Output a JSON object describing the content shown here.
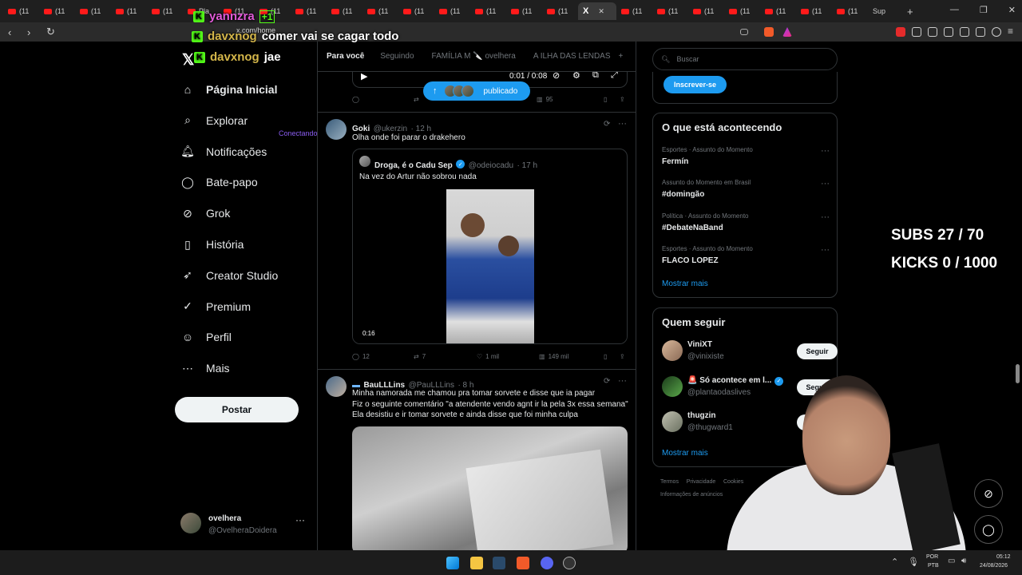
{
  "browser": {
    "tabs": [
      "(11",
      "(11",
      "(11",
      "(11",
      "(11",
      "Pla",
      "(11",
      "(11",
      "(11",
      "(11",
      "(11",
      "(11",
      "(11",
      "(11",
      "(11",
      "(11",
      "(11",
      "(11",
      "(11",
      "(11",
      "(11",
      "(11",
      "(11"
    ],
    "active_tab_icon": "X",
    "last_tab": "Sup",
    "url": "x.com/home"
  },
  "chat": [
    {
      "user": "yannzra",
      "message": "",
      "color": "#e15bd8"
    },
    {
      "user": "davxnog",
      "message": "comer vai se cagar todo",
      "color": "#d4b64a"
    },
    {
      "user": "davxnog",
      "message": "jae",
      "color": "#d4b64a"
    }
  ],
  "stream_overlay": {
    "subs": "SUBS 27 / 70",
    "kicks": "KICKS 0 / 1000",
    "connecting_text": "Conectando"
  },
  "sidebar": {
    "items": [
      {
        "label": "Página Inicial",
        "icon": "home-icon"
      },
      {
        "label": "Explorar",
        "icon": "search-icon"
      },
      {
        "label": "Notificações",
        "icon": "bell-icon"
      },
      {
        "label": "Bate-papo",
        "icon": "chat-icon"
      },
      {
        "label": "Grok",
        "icon": "grok-icon"
      },
      {
        "label": "História",
        "icon": "bookmark-icon"
      },
      {
        "label": "Creator Studio",
        "icon": "rocket-icon"
      },
      {
        "label": "Premium",
        "icon": "verified-icon"
      },
      {
        "label": "Perfil",
        "icon": "person-icon"
      },
      {
        "label": "Mais",
        "icon": "more-icon"
      }
    ],
    "post_button": "Postar",
    "account": {
      "name": "ovelhera",
      "handle": "@OvelheraDoidera"
    }
  },
  "feed": {
    "tabs": [
      "Para você",
      "Seguindo",
      "FAMÍLIA M 🔪 ovelhera",
      "A ILHA DAS LENDAS"
    ],
    "add_tab": "+",
    "video_time": "0:01 / 0:08",
    "published_pill": "publicado",
    "first_tweet_views": "95",
    "tweets": [
      {
        "name": "Goki",
        "handle": "@ukerzin",
        "time": "· 12 h",
        "text": "Olha onde foi parar o drakehero",
        "quote": {
          "name": "Droga, é o Cadu Sep",
          "handle": "@odeiocadu",
          "time": "· 17 h",
          "text": "Na vez do Artur não sobrou nada",
          "video_duration": "0:16"
        },
        "replies": "12",
        "retweets": "7",
        "likes": "1 mil",
        "views": "149 mil"
      },
      {
        "name": "BauLLLins",
        "handle": "@PauLLLins",
        "time": "· 8 h",
        "lines": [
          "Minha namorada me chamou pra tomar sorvete e disse que ia pagar",
          "Fiz o seguinte comentário \"a atendente vendo agnt ir la pela 3x essa semana\"",
          "Ela desistiu e ir tomar sorvete e ainda disse que foi minha culpa"
        ]
      }
    ]
  },
  "right": {
    "search_placeholder": "Buscar",
    "subscribe_button": "Inscrever-se",
    "trends_title": "O que está acontecendo",
    "trends": [
      {
        "meta": "Esportes · Assunto do Momento",
        "name": "Fermín"
      },
      {
        "meta": "Assunto do Momento em Brasil",
        "name": "#domingão"
      },
      {
        "meta": "Política · Assunto do Momento",
        "name": "#DebateNaBand"
      },
      {
        "meta": "Esportes · Assunto do Momento",
        "name": "FLACO LOPEZ"
      }
    ],
    "show_more": "Mostrar mais",
    "follow_title": "Quem seguir",
    "follow": [
      {
        "name": "ViniXT",
        "handle": "@vinixiste"
      },
      {
        "name": "🚨 Só acontece em l...",
        "handle": "@plantaodaslives"
      },
      {
        "name": "thugzin",
        "handle": "@thugward1"
      }
    ],
    "follow_button": "Seguir",
    "footer": [
      "Termos",
      "Privacidade",
      "Cookies"
    ],
    "footer2": "Informações de anúncios"
  },
  "taskbar": {
    "lang": "POR",
    "layout": "PTB",
    "time": "05:12",
    "date": "24/08/2026"
  }
}
